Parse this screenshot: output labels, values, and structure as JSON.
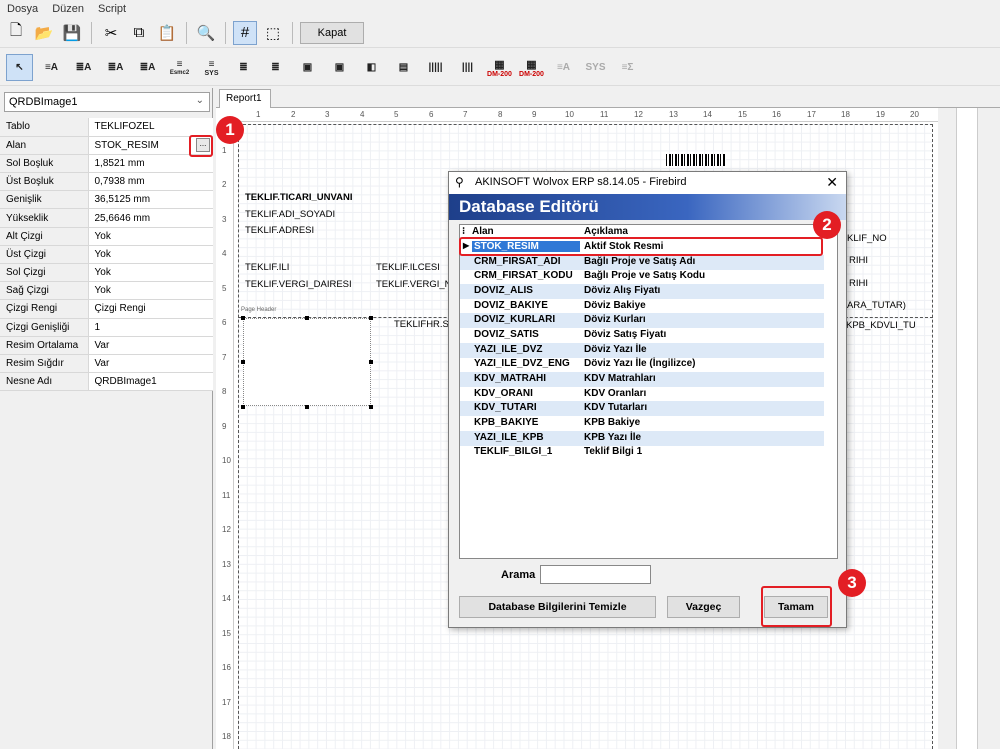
{
  "menu": {
    "items": [
      "Dosya",
      "Düzen",
      "Script"
    ]
  },
  "toolbar1": {
    "close_label": "Kapat"
  },
  "toolbar2": {
    "esmc_label": "Esmc2",
    "sys_label": "SYS",
    "dm_label_1": "DM-200",
    "dm_label_2": "DM-200"
  },
  "left": {
    "component_select": "QRDBImage1",
    "properties": [
      {
        "name": "Tablo",
        "value": "TEKLIFOZEL"
      },
      {
        "name": "Alan",
        "value": "STOK_RESIM"
      },
      {
        "name": "Sol Boşluk",
        "value": "1,8521 mm"
      },
      {
        "name": "Üst Boşluk",
        "value": "0,7938 mm"
      },
      {
        "name": "Genişlik",
        "value": "36,5125 mm"
      },
      {
        "name": "Yükseklik",
        "value": "25,6646 mm"
      },
      {
        "name": "Alt Çizgi",
        "value": "Yok"
      },
      {
        "name": "Üst Çizgi",
        "value": "Yok"
      },
      {
        "name": "Sol Çizgi",
        "value": "Yok"
      },
      {
        "name": "Sağ Çizgi",
        "value": "Yok"
      },
      {
        "name": "Çizgi Rengi",
        "value": "Çizgi Rengi"
      },
      {
        "name": "Çizgi Genişliği",
        "value": "1"
      },
      {
        "name": "Resim Ortalama",
        "value": "Var"
      },
      {
        "name": "Resim Sığdır",
        "value": "Var"
      },
      {
        "name": "Nesne Adı",
        "value": "QRDBImage1"
      }
    ],
    "ellipsis": "..."
  },
  "report": {
    "tab": "Report1",
    "ruler_h": [
      "1",
      "2",
      "3",
      "4",
      "5",
      "6",
      "7",
      "8",
      "9",
      "10",
      "11",
      "12",
      "13",
      "14",
      "15",
      "16",
      "17",
      "18",
      "19",
      "20"
    ],
    "ruler_v": [
      "1",
      "2",
      "3",
      "4",
      "5",
      "6",
      "7",
      "8",
      "9",
      "10",
      "11",
      "12",
      "13",
      "14",
      "15",
      "16",
      "17",
      "18"
    ],
    "fields": {
      "unvan": "TEKLIF.TICARI_UNVANI",
      "adsoyad": "TEKLIF.ADI_SOYADI",
      "adres": "TEKLIF.ADRESI",
      "ili": "TEKLIF.ILI",
      "ilcesi": "TEKLIF.ILCESI",
      "vergi_dairesi": "TEKLIF.VERGI_DAIRESI",
      "vergi_no": "TEKLIF.VERGI_N",
      "teklifhr": "TEKLIFHR.ST",
      "page_header": "Page Header",
      "r_no": "KLIF_NO",
      "r_tarihi1": "RIHI",
      "r_tarihi2": "RIHI",
      "r_ara_tutar": "ARA_TUTAR)",
      "r_kdv": "KPB_KDVLI_TU"
    }
  },
  "dialog": {
    "title": "AKINSOFT Wolvox ERP s8.14.05 - Firebird",
    "close": "✕",
    "header": "Database Editörü",
    "col_alan": "Alan",
    "col_aciklama": "Açıklama",
    "rows": [
      {
        "alan": "STOK_RESIM",
        "aciklama": "Aktif Stok Resmi"
      },
      {
        "alan": "CRM_FIRSAT_ADI",
        "aciklama": "Bağlı Proje ve Satış Adı"
      },
      {
        "alan": "CRM_FIRSAT_KODU",
        "aciklama": "Bağlı Proje ve Satış Kodu"
      },
      {
        "alan": "DOVIZ_ALIS",
        "aciklama": "Döviz Alış Fiyatı"
      },
      {
        "alan": "DOVIZ_BAKIYE",
        "aciklama": "Döviz Bakiye"
      },
      {
        "alan": "DOVIZ_KURLARI",
        "aciklama": "Döviz Kurları"
      },
      {
        "alan": "DOVIZ_SATIS",
        "aciklama": "Döviz Satış Fiyatı"
      },
      {
        "alan": "YAZI_ILE_DVZ",
        "aciklama": "Döviz Yazı İle"
      },
      {
        "alan": "YAZI_ILE_DVZ_ENG",
        "aciklama": "Döviz Yazı İle (İngilizce)"
      },
      {
        "alan": "KDV_MATRAHI",
        "aciklama": "KDV Matrahları"
      },
      {
        "alan": "KDV_ORANI",
        "aciklama": "KDV Oranları"
      },
      {
        "alan": "KDV_TUTARI",
        "aciklama": "KDV Tutarları"
      },
      {
        "alan": "KPB_BAKIYE",
        "aciklama": "KPB Bakiye"
      },
      {
        "alan": "YAZI_ILE_KPB",
        "aciklama": "KPB Yazı İle"
      },
      {
        "alan": "TEKLIF_BILGI_1",
        "aciklama": "Teklif Bilgi 1"
      }
    ],
    "search_label": "Arama",
    "search_value": "",
    "btn_clear": "Database Bilgilerini Temizle",
    "btn_cancel": "Vazgeç",
    "btn_ok": "Tamam"
  },
  "badges": [
    "1",
    "2",
    "3"
  ],
  "colors": {
    "accent_red": "#e31e24",
    "selected_blue": "#2f78d6",
    "alt_row": "#dde9f7"
  }
}
